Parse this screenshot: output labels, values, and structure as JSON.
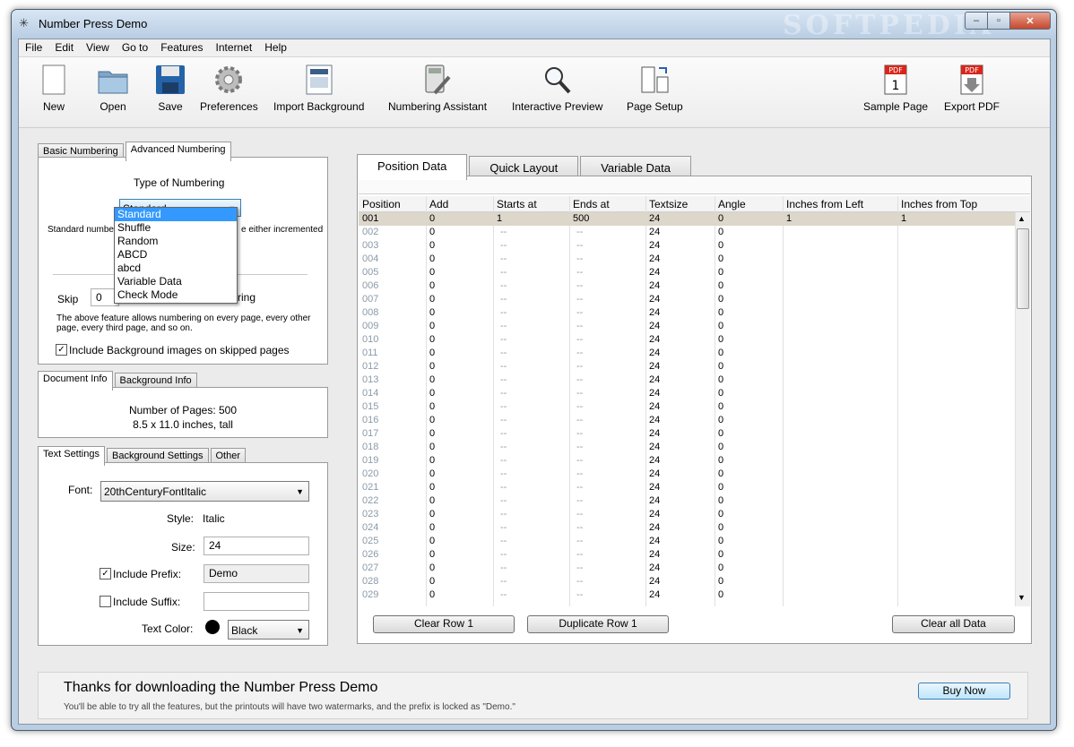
{
  "window": {
    "title": "Number Press Demo",
    "watermark": "SOFTPEDIA",
    "buttons": [
      "–",
      "▫",
      "✕"
    ]
  },
  "menu": [
    "File",
    "Edit",
    "View",
    "Go to",
    "Features",
    "Internet",
    "Help"
  ],
  "toolbar": [
    {
      "label": "New",
      "icon": "new-document-icon"
    },
    {
      "label": "Open",
      "icon": "folder-icon"
    },
    {
      "label": "Save",
      "icon": "floppy-disk-icon"
    },
    {
      "label": "Preferences",
      "icon": "gear-icon"
    },
    {
      "label": "Import Background",
      "icon": "import-background-icon"
    },
    {
      "label": "Numbering Assistant",
      "icon": "calculator-icon"
    },
    {
      "label": "Interactive Preview",
      "icon": "magnifier-icon"
    },
    {
      "label": "Page Setup",
      "icon": "page-setup-icon"
    },
    {
      "label": "Sample Page",
      "icon": "pdf-page-icon"
    },
    {
      "label": "Export PDF",
      "icon": "pdf-export-icon"
    }
  ],
  "numbering_tabs": [
    "Basic Numbering",
    "Advanced Numbering"
  ],
  "numbering": {
    "type_label": "Type of Numbering",
    "type_value": "Standard",
    "options": [
      "Standard",
      "Shuffle",
      "Random",
      "ABCD",
      "abcd",
      "Variable Data",
      "Check Mode"
    ],
    "desc_left": "Standard number",
    "desc_right": "e either incremented",
    "skip_label": "Skip",
    "skip_value": "0",
    "skip_suffix": "ring",
    "skip_desc": "The above feature allows numbering on every page, every other page, every third page, and so on.",
    "include_bg_label": "Include Background images on skipped pages",
    "include_bg_checked": true
  },
  "doc_tabs": [
    "Document Info",
    "Background Info"
  ],
  "doc_info": {
    "pages": "Number of Pages: 500",
    "size": "8.5 x 11.0 inches, tall"
  },
  "text_tabs": [
    "Text Settings",
    "Background Settings",
    "Other"
  ],
  "text_settings": {
    "font_label": "Font:",
    "font_value": "20thCenturyFontItalic",
    "style_label": "Style:",
    "style_value": "Italic",
    "size_label": "Size:",
    "size_value": "24",
    "prefix_label": "Include Prefix:",
    "prefix_checked": true,
    "prefix_value": "Demo",
    "suffix_label": "Include Suffix:",
    "suffix_checked": false,
    "suffix_value": "",
    "color_label": "Text Color:",
    "color_value": "Black",
    "color_hex": "#000000"
  },
  "data_tabs": [
    "Position Data",
    "Quick Layout",
    "Variable Data"
  ],
  "grid": {
    "columns": [
      "Position",
      "Add",
      "Starts at",
      "Ends at",
      "Textsize",
      "Angle",
      "Inches from Left",
      "Inches from Top"
    ],
    "rows": [
      [
        "001",
        "0",
        "1",
        "500",
        "24",
        "0",
        "1",
        "1"
      ],
      [
        "002",
        "0",
        "--",
        "--",
        "24",
        "0",
        "",
        ""
      ],
      [
        "003",
        "0",
        "--",
        "--",
        "24",
        "0",
        "",
        ""
      ],
      [
        "004",
        "0",
        "--",
        "--",
        "24",
        "0",
        "",
        ""
      ],
      [
        "005",
        "0",
        "--",
        "--",
        "24",
        "0",
        "",
        ""
      ],
      [
        "006",
        "0",
        "--",
        "--",
        "24",
        "0",
        "",
        ""
      ],
      [
        "007",
        "0",
        "--",
        "--",
        "24",
        "0",
        "",
        ""
      ],
      [
        "008",
        "0",
        "--",
        "--",
        "24",
        "0",
        "",
        ""
      ],
      [
        "009",
        "0",
        "--",
        "--",
        "24",
        "0",
        "",
        ""
      ],
      [
        "010",
        "0",
        "--",
        "--",
        "24",
        "0",
        "",
        ""
      ],
      [
        "011",
        "0",
        "--",
        "--",
        "24",
        "0",
        "",
        ""
      ],
      [
        "012",
        "0",
        "--",
        "--",
        "24",
        "0",
        "",
        ""
      ],
      [
        "013",
        "0",
        "--",
        "--",
        "24",
        "0",
        "",
        ""
      ],
      [
        "014",
        "0",
        "--",
        "--",
        "24",
        "0",
        "",
        ""
      ],
      [
        "015",
        "0",
        "--",
        "--",
        "24",
        "0",
        "",
        ""
      ],
      [
        "016",
        "0",
        "--",
        "--",
        "24",
        "0",
        "",
        ""
      ],
      [
        "017",
        "0",
        "--",
        "--",
        "24",
        "0",
        "",
        ""
      ],
      [
        "018",
        "0",
        "--",
        "--",
        "24",
        "0",
        "",
        ""
      ],
      [
        "019",
        "0",
        "--",
        "--",
        "24",
        "0",
        "",
        ""
      ],
      [
        "020",
        "0",
        "--",
        "--",
        "24",
        "0",
        "",
        ""
      ],
      [
        "021",
        "0",
        "--",
        "--",
        "24",
        "0",
        "",
        ""
      ],
      [
        "022",
        "0",
        "--",
        "--",
        "24",
        "0",
        "",
        ""
      ],
      [
        "023",
        "0",
        "--",
        "--",
        "24",
        "0",
        "",
        ""
      ],
      [
        "024",
        "0",
        "--",
        "--",
        "24",
        "0",
        "",
        ""
      ],
      [
        "025",
        "0",
        "--",
        "--",
        "24",
        "0",
        "",
        ""
      ],
      [
        "026",
        "0",
        "--",
        "--",
        "24",
        "0",
        "",
        ""
      ],
      [
        "027",
        "0",
        "--",
        "--",
        "24",
        "0",
        "",
        ""
      ],
      [
        "028",
        "0",
        "--",
        "--",
        "24",
        "0",
        "",
        ""
      ],
      [
        "029",
        "0",
        "--",
        "--",
        "24",
        "0",
        "",
        ""
      ]
    ],
    "buttons": {
      "clear_row": "Clear Row 1",
      "duplicate_row": "Duplicate Row 1",
      "clear_all": "Clear all Data"
    }
  },
  "footer": {
    "title": "Thanks for downloading the Number Press Demo",
    "subtitle": "You'll be able to try all the features, but the printouts will have two watermarks, and the prefix is locked as \"Demo.\"",
    "buy_label": "Buy Now"
  }
}
